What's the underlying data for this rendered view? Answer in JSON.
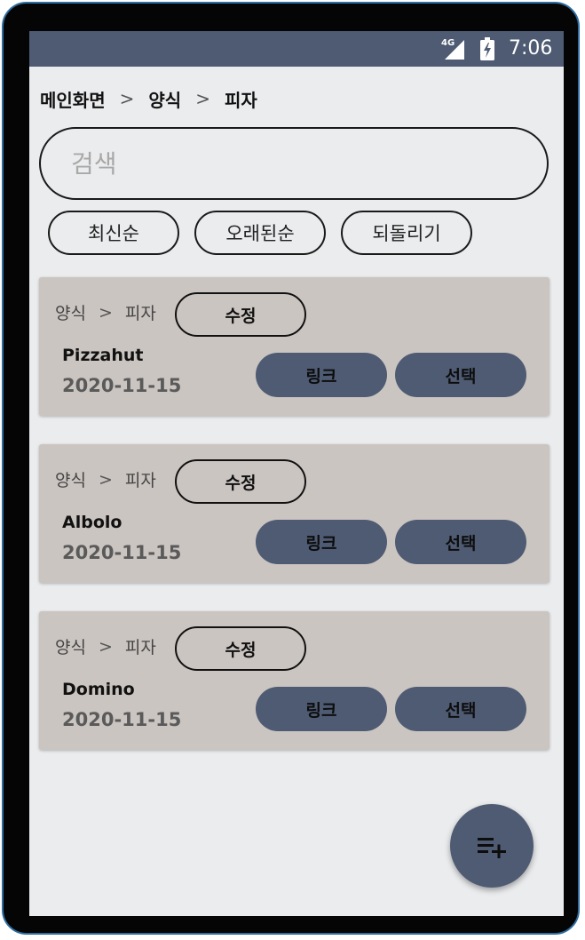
{
  "status_bar": {
    "network": "4G",
    "time": "7:06",
    "icons": [
      "signal-icon",
      "battery-charging-icon"
    ]
  },
  "breadcrumb": {
    "items": [
      "메인화면",
      "양식",
      "피자"
    ],
    "separator": ">"
  },
  "search": {
    "placeholder": "검색",
    "value": ""
  },
  "sort_buttons": [
    "최신순",
    "오래된순",
    "되돌리기"
  ],
  "cards": [
    {
      "category": "양식",
      "separator": ">",
      "subcategory": "피자",
      "edit_label": "수정",
      "name": "Pizzahut",
      "date": "2020-11-15",
      "link_label": "링크",
      "select_label": "선택"
    },
    {
      "category": "양식",
      "separator": ">",
      "subcategory": "피자",
      "edit_label": "수정",
      "name": "Albolo",
      "date": "2020-11-15",
      "link_label": "링크",
      "select_label": "선택"
    },
    {
      "category": "양식",
      "separator": ">",
      "subcategory": "피자",
      "edit_label": "수정",
      "name": "Domino",
      "date": "2020-11-15",
      "link_label": "링크",
      "select_label": "선택"
    }
  ],
  "fab": {
    "icon": "playlist-add-icon"
  },
  "colors": {
    "accent": "#4e5b73",
    "background": "#ebecee",
    "card": "#cbc5c1",
    "frame": "#050505"
  }
}
